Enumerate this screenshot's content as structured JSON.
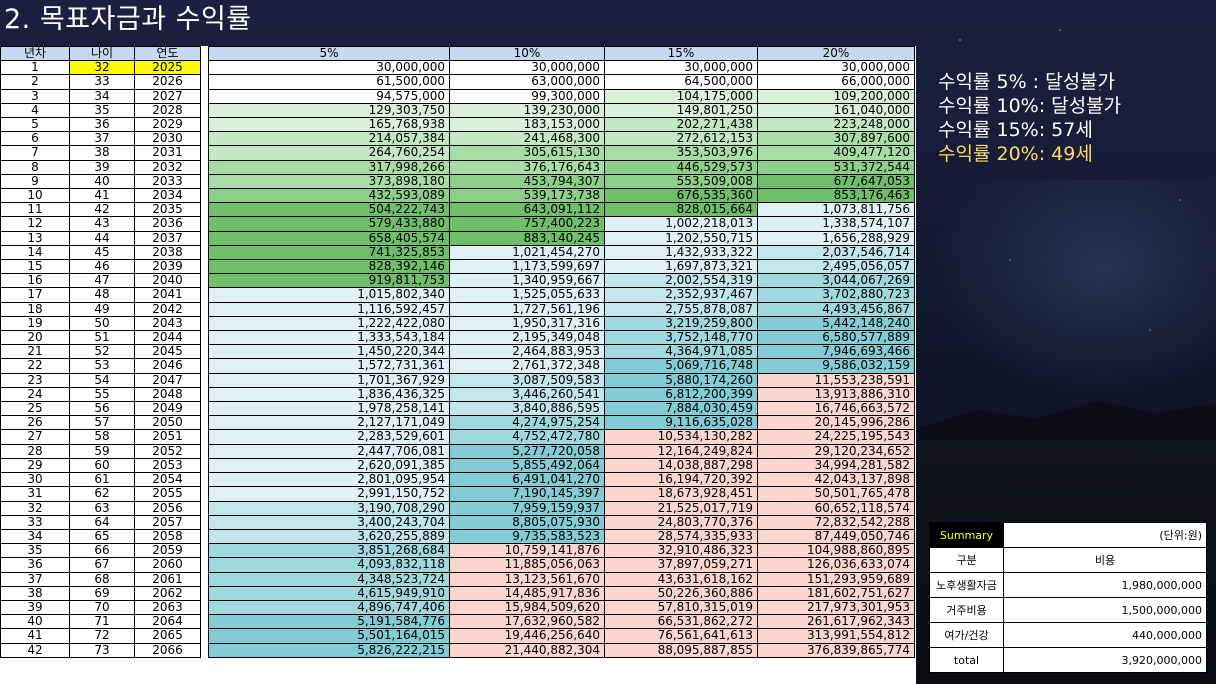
{
  "title": "2. 목표자금과 수익률",
  "columns": [
    "년차",
    "나이",
    "연도",
    "5%",
    "10%",
    "15%",
    "20%"
  ],
  "rows": [
    [
      "1",
      "32",
      "2025",
      "30,000,000",
      "30,000,000",
      "30,000,000",
      "30,000,000"
    ],
    [
      "2",
      "33",
      "2026",
      "61,500,000",
      "63,000,000",
      "64,500,000",
      "66,000,000"
    ],
    [
      "3",
      "34",
      "2027",
      "94,575,000",
      "99,300,000",
      "104,175,000",
      "109,200,000"
    ],
    [
      "4",
      "35",
      "2028",
      "129,303,750",
      "139,230,000",
      "149,801,250",
      "161,040,000"
    ],
    [
      "5",
      "36",
      "2029",
      "165,768,938",
      "183,153,000",
      "202,271,438",
      "223,248,000"
    ],
    [
      "6",
      "37",
      "2030",
      "214,057,384",
      "241,468,300",
      "272,612,153",
      "307,897,600"
    ],
    [
      "7",
      "38",
      "2031",
      "264,760,254",
      "305,615,130",
      "353,503,976",
      "409,477,120"
    ],
    [
      "8",
      "39",
      "2032",
      "317,998,266",
      "376,176,643",
      "446,529,573",
      "531,372,544"
    ],
    [
      "9",
      "40",
      "2033",
      "373,898,180",
      "453,794,307",
      "553,509,008",
      "677,647,053"
    ],
    [
      "10",
      "41",
      "2034",
      "432,593,089",
      "539,173,738",
      "676,535,360",
      "853,176,463"
    ],
    [
      "11",
      "42",
      "2035",
      "504,222,743",
      "643,091,112",
      "828,015,664",
      "1,073,811,756"
    ],
    [
      "12",
      "43",
      "2036",
      "579,433,880",
      "757,400,223",
      "1,002,218,013",
      "1,338,574,107"
    ],
    [
      "13",
      "44",
      "2037",
      "658,405,574",
      "883,140,245",
      "1,202,550,715",
      "1,656,288,929"
    ],
    [
      "14",
      "45",
      "2038",
      "741,325,853",
      "1,021,454,270",
      "1,432,933,322",
      "2,037,546,714"
    ],
    [
      "15",
      "46",
      "2039",
      "828,392,146",
      "1,173,599,697",
      "1,697,873,321",
      "2,495,056,057"
    ],
    [
      "16",
      "47",
      "2040",
      "919,811,753",
      "1,340,959,667",
      "2,002,554,319",
      "3,044,067,269"
    ],
    [
      "17",
      "48",
      "2041",
      "1,015,802,340",
      "1,525,055,633",
      "2,352,937,467",
      "3,702,880,723"
    ],
    [
      "18",
      "49",
      "2042",
      "1,116,592,457",
      "1,727,561,196",
      "2,755,878,087",
      "4,493,456,867"
    ],
    [
      "19",
      "50",
      "2043",
      "1,222,422,080",
      "1,950,317,316",
      "3,219,259,800",
      "5,442,148,240"
    ],
    [
      "20",
      "51",
      "2044",
      "1,333,543,184",
      "2,195,349,048",
      "3,752,148,770",
      "6,580,577,889"
    ],
    [
      "21",
      "52",
      "2045",
      "1,450,220,344",
      "2,464,883,953",
      "4,364,971,085",
      "7,946,693,466"
    ],
    [
      "22",
      "53",
      "2046",
      "1,572,731,361",
      "2,761,372,348",
      "5,069,716,748",
      "9,586,032,159"
    ],
    [
      "23",
      "54",
      "2047",
      "1,701,367,929",
      "3,087,509,583",
      "5,880,174,260",
      "11,553,238,591"
    ],
    [
      "24",
      "55",
      "2048",
      "1,836,436,325",
      "3,446,260,541",
      "6,812,200,399",
      "13,913,886,310"
    ],
    [
      "25",
      "56",
      "2049",
      "1,978,258,141",
      "3,840,886,595",
      "7,884,030,459",
      "16,746,663,572"
    ],
    [
      "26",
      "57",
      "2050",
      "2,127,171,049",
      "4,274,975,254",
      "9,116,635,028",
      "20,145,996,286"
    ],
    [
      "27",
      "58",
      "2051",
      "2,283,529,601",
      "4,752,472,780",
      "10,534,130,282",
      "24,225,195,543"
    ],
    [
      "28",
      "59",
      "2052",
      "2,447,706,081",
      "5,277,720,058",
      "12,164,249,824",
      "29,120,234,652"
    ],
    [
      "29",
      "60",
      "2053",
      "2,620,091,385",
      "5,855,492,064",
      "14,038,887,298",
      "34,994,281,582"
    ],
    [
      "30",
      "61",
      "2054",
      "2,801,095,954",
      "6,491,041,270",
      "16,194,720,392",
      "42,043,137,898"
    ],
    [
      "31",
      "62",
      "2055",
      "2,991,150,752",
      "7,190,145,397",
      "18,673,928,451",
      "50,501,765,478"
    ],
    [
      "32",
      "63",
      "2056",
      "3,190,708,290",
      "7,959,159,937",
      "21,525,017,719",
      "60,652,118,574"
    ],
    [
      "33",
      "64",
      "2057",
      "3,400,243,704",
      "8,805,075,930",
      "24,803,770,376",
      "72,832,542,288"
    ],
    [
      "34",
      "65",
      "2058",
      "3,620,255,889",
      "9,735,583,523",
      "28,574,335,933",
      "87,449,050,746"
    ],
    [
      "35",
      "66",
      "2059",
      "3,851,268,684",
      "10,759,141,876",
      "32,910,486,323",
      "104,988,860,895"
    ],
    [
      "36",
      "67",
      "2060",
      "4,093,832,118",
      "11,885,056,063",
      "37,897,059,271",
      "126,036,633,074"
    ],
    [
      "37",
      "68",
      "2061",
      "4,348,523,724",
      "13,123,561,670",
      "43,631,618,162",
      "151,293,959,689"
    ],
    [
      "38",
      "69",
      "2062",
      "4,615,949,910",
      "14,485,917,836",
      "50,226,360,886",
      "181,602,751,627"
    ],
    [
      "39",
      "70",
      "2063",
      "4,896,747,406",
      "15,984,509,620",
      "57,810,315,019",
      "217,973,301,953"
    ],
    [
      "40",
      "71",
      "2064",
      "5,191,584,776",
      "17,632,960,582",
      "66,531,862,272",
      "261,617,962,343"
    ],
    [
      "41",
      "72",
      "2065",
      "5,501,164,015",
      "19,446,256,640",
      "76,561,641,613",
      "313,991,554,812"
    ],
    [
      "42",
      "73",
      "2066",
      "5,826,222,215",
      "21,440,882,304",
      "88,095,887,855",
      "376,839,865,774"
    ]
  ],
  "cell_colors": {
    "c5": [
      "#ffffff",
      "#ffffff",
      "#ffffff",
      "#d9f0d9",
      "#d9f0d9",
      "#c2e7c2",
      "#c2e7c2",
      "#a8dda6",
      "#a8dda6",
      "#8ccf89",
      "#6fbf6a",
      "#6fbf6a",
      "#6fbf6a",
      "#6fbf6a",
      "#6fbf6a",
      "#6fbf6a",
      "#dff1f4",
      "#dff1f4",
      "#dff1f4",
      "#dff1f4",
      "#dff1f4",
      "#dff1f4",
      "#dff1f4",
      "#dff1f4",
      "#dff1f4",
      "#dff1f4",
      "#dff1f4",
      "#dff1f4",
      "#dff1f4",
      "#dff1f4",
      "#dff1f4",
      "#c2e6ec",
      "#c2e6ec",
      "#c2e6ec",
      "#a0d8df",
      "#a0d8df",
      "#a0d8df",
      "#a0d8df",
      "#a0d8df",
      "#84ccd5",
      "#84ccd5",
      "#84ccd5"
    ],
    "c10": [
      "#ffffff",
      "#ffffff",
      "#ffffff",
      "#d9f0d9",
      "#d9f0d9",
      "#c2e7c2",
      "#a8dda6",
      "#a8dda6",
      "#8ccf89",
      "#8ccf89",
      "#6fbf6a",
      "#6fbf6a",
      "#6fbf6a",
      "#dff1f4",
      "#dff1f4",
      "#dff1f4",
      "#dff1f4",
      "#dff1f4",
      "#dff1f4",
      "#dff1f4",
      "#dff1f4",
      "#dff1f4",
      "#c2e6ec",
      "#c2e6ec",
      "#c2e6ec",
      "#a0d8df",
      "#a0d8df",
      "#84ccd5",
      "#84ccd5",
      "#84ccd5",
      "#84ccd5",
      "#84ccd5",
      "#84ccd5",
      "#84ccd5",
      "#fbd6cf",
      "#fbd6cf",
      "#fbd6cf",
      "#fbd6cf",
      "#fbd6cf",
      "#fbd6cf",
      "#fbd6cf",
      "#fbd6cf"
    ],
    "c15": [
      "#ffffff",
      "#ffffff",
      "#d9f0d9",
      "#d9f0d9",
      "#c2e7c2",
      "#c2e7c2",
      "#a8dda6",
      "#8ccf89",
      "#8ccf89",
      "#6fbf6a",
      "#6fbf6a",
      "#dff1f4",
      "#dff1f4",
      "#dff1f4",
      "#dff1f4",
      "#c2e6ec",
      "#c2e6ec",
      "#c2e6ec",
      "#a0d8df",
      "#a0d8df",
      "#a0d8df",
      "#84ccd5",
      "#84ccd5",
      "#84ccd5",
      "#84ccd5",
      "#84ccd5",
      "#fbd6cf",
      "#fbd6cf",
      "#fbd6cf",
      "#fbd6cf",
      "#fbd6cf",
      "#fbd6cf",
      "#fbd6cf",
      "#fbd6cf",
      "#fbd6cf",
      "#fbd6cf",
      "#fbd6cf",
      "#fbd6cf",
      "#fbd6cf",
      "#fbd6cf",
      "#fbd6cf",
      "#fbd6cf"
    ],
    "c20": [
      "#ffffff",
      "#ffffff",
      "#d9f0d9",
      "#d9f0d9",
      "#c2e7c2",
      "#a8dda6",
      "#a8dda6",
      "#8ccf89",
      "#6fbf6a",
      "#6fbf6a",
      "#dff1f4",
      "#dff1f4",
      "#dff1f4",
      "#c2e6ec",
      "#c2e6ec",
      "#a0d8df",
      "#a0d8df",
      "#a0d8df",
      "#84ccd5",
      "#84ccd5",
      "#84ccd5",
      "#84ccd5",
      "#fbd6cf",
      "#fbd6cf",
      "#fbd6cf",
      "#fbd6cf",
      "#fbd6cf",
      "#fbd6cf",
      "#fbd6cf",
      "#fbd6cf",
      "#fbd6cf",
      "#fbd6cf",
      "#fbd6cf",
      "#fbd6cf",
      "#fbd6cf",
      "#fbd6cf",
      "#fbd6cf",
      "#fbd6cf",
      "#fbd6cf",
      "#fbd6cf",
      "#fbd6cf",
      "#fbd6cf"
    ]
  },
  "notes": [
    {
      "text": "수익률 5% : 달성불가",
      "color": "#ffffff"
    },
    {
      "text": "수익률 10%: 달성불가",
      "color": "#ffffff"
    },
    {
      "text": "수익률 15%: 57세",
      "color": "#ffffff"
    },
    {
      "text": "수익률 20%: 49세",
      "color": "#ffd966"
    }
  ],
  "summary": {
    "title": "Summary",
    "unit": "(단위:원)",
    "header": [
      "구분",
      "비용"
    ],
    "rows": [
      [
        "노후생활자금",
        "1,980,000,000"
      ],
      [
        "거주비용",
        "1,500,000,000"
      ],
      [
        "여가/건강",
        "440,000,000"
      ],
      [
        "total",
        "3,920,000,000"
      ]
    ]
  }
}
